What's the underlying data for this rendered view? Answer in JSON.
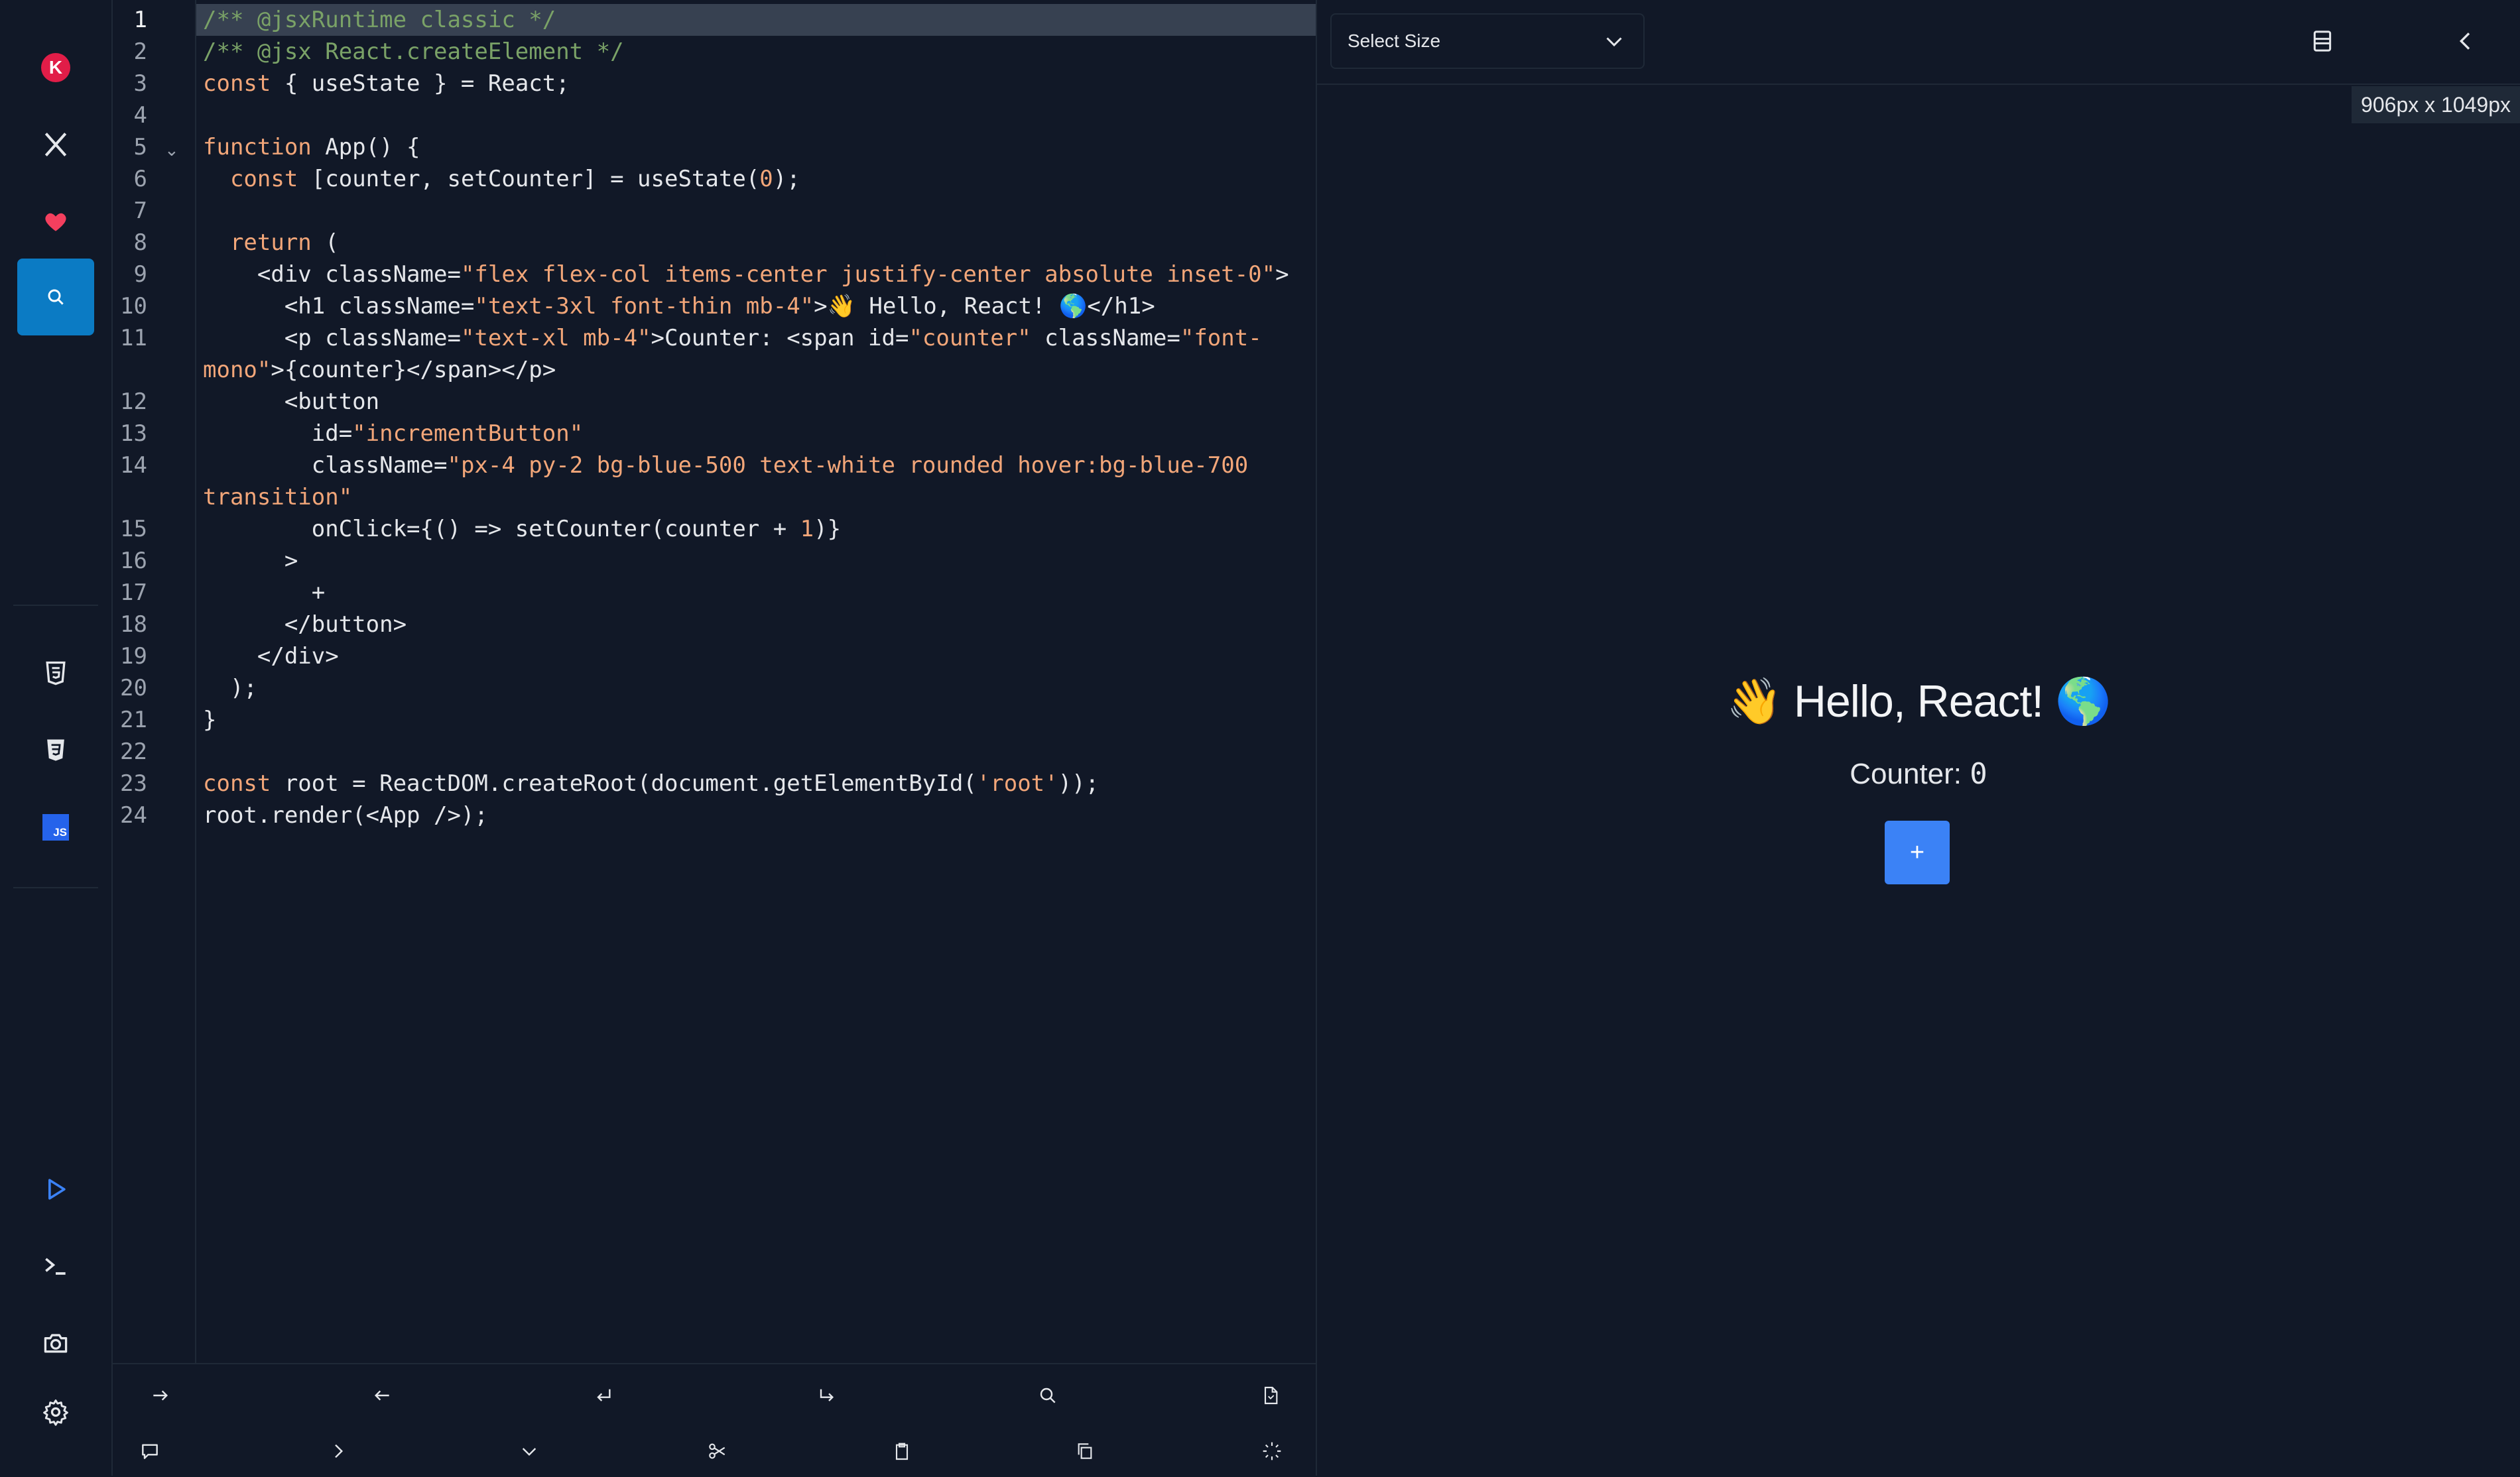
{
  "sidebar": {
    "top_icons": [
      "app-logo-icon",
      "x-twitter-icon",
      "heart-icon",
      "search-icon"
    ],
    "file_icons": [
      "html5-icon",
      "css3-icon",
      "javascript-icon"
    ],
    "bottom_icons": [
      "play-icon",
      "terminal-icon",
      "camera-icon",
      "settings-icon"
    ],
    "js_badge": "JS",
    "logo_letter": "K"
  },
  "editor": {
    "active_line": 1,
    "line_numbers": [
      "1",
      "2",
      "3",
      "4",
      "5",
      "6",
      "7",
      "8",
      "9",
      "10",
      "11",
      "",
      "12",
      "13",
      "14",
      "",
      "15",
      "16",
      "17",
      "18",
      "19",
      "20",
      "21",
      "22",
      "23",
      "24"
    ],
    "fold_marker": "⌄"
  },
  "code": [
    [
      {
        "t": "cm",
        "v": "/** @jsxRuntime classic */"
      }
    ],
    [
      {
        "t": "cm",
        "v": "/** @jsx React.createElement */"
      }
    ],
    [
      {
        "t": "kw",
        "v": "const"
      },
      {
        "t": "pl",
        "v": " { useState } = React;"
      }
    ],
    [],
    [
      {
        "t": "kw",
        "v": "function"
      },
      {
        "t": "pl",
        "v": " App() {"
      }
    ],
    [
      {
        "t": "pl",
        "v": "  "
      },
      {
        "t": "kw",
        "v": "const"
      },
      {
        "t": "pl",
        "v": " [counter, setCounter] = useState("
      },
      {
        "t": "num",
        "v": "0"
      },
      {
        "t": "pl",
        "v": ");"
      }
    ],
    [],
    [
      {
        "t": "pl",
        "v": "  "
      },
      {
        "t": "kw",
        "v": "return"
      },
      {
        "t": "pl",
        "v": " ("
      }
    ],
    [
      {
        "t": "pl",
        "v": "    <div className="
      },
      {
        "t": "str",
        "v": "\"flex flex-col items-center justify-center absolute inset-0\""
      },
      {
        "t": "pl",
        "v": ">"
      }
    ],
    [
      {
        "t": "pl",
        "v": "      <h1 className="
      },
      {
        "t": "str",
        "v": "\"text-3xl font-thin mb-4\""
      },
      {
        "t": "pl",
        "v": ">👋 Hello, React! 🌎</h1>"
      }
    ],
    [
      {
        "t": "pl",
        "v": "      <p className="
      },
      {
        "t": "str",
        "v": "\"text-xl mb-4\""
      },
      {
        "t": "pl",
        "v": ">Counter: <span id="
      },
      {
        "t": "str",
        "v": "\"counter\""
      },
      {
        "t": "pl",
        "v": " className="
      },
      {
        "t": "str",
        "v": "\"font-"
      }
    ],
    [
      {
        "t": "str",
        "v": "mono\""
      },
      {
        "t": "pl",
        "v": ">{counter}</span></p>"
      }
    ],
    [
      {
        "t": "pl",
        "v": "      <button"
      }
    ],
    [
      {
        "t": "pl",
        "v": "        id="
      },
      {
        "t": "str",
        "v": "\"incrementButton\""
      }
    ],
    [
      {
        "t": "pl",
        "v": "        className="
      },
      {
        "t": "str",
        "v": "\"px-4 py-2 bg-blue-500 text-white rounded hover:bg-blue-700"
      }
    ],
    [
      {
        "t": "str",
        "v": "transition\""
      }
    ],
    [
      {
        "t": "pl",
        "v": "        onClick={() => setCounter(counter + "
      },
      {
        "t": "num",
        "v": "1"
      },
      {
        "t": "pl",
        "v": ")}"
      }
    ],
    [
      {
        "t": "pl",
        "v": "      >"
      }
    ],
    [
      {
        "t": "pl",
        "v": "        +"
      }
    ],
    [
      {
        "t": "pl",
        "v": "      </button>"
      }
    ],
    [
      {
        "t": "pl",
        "v": "    </div>"
      }
    ],
    [
      {
        "t": "pl",
        "v": "  );"
      }
    ],
    [
      {
        "t": "pl",
        "v": "}"
      }
    ],
    [],
    [
      {
        "t": "kw",
        "v": "const"
      },
      {
        "t": "pl",
        "v": " root = ReactDOM.createRoot(document.getElementById("
      },
      {
        "t": "str",
        "v": "'root'"
      },
      {
        "t": "pl",
        "v": "));"
      }
    ],
    [
      {
        "t": "pl",
        "v": "root.render(<App />);"
      }
    ]
  ],
  "toolbar": {
    "row1": [
      "indent-icon",
      "outdent-icon",
      "newline-icon",
      "line-break-icon",
      "search-icon",
      "format-document-icon"
    ],
    "row2": [
      "comment-icon",
      "chevron-right-icon",
      "chevron-down-icon",
      "cut-icon",
      "paste-icon",
      "copy-icon",
      "magic-icon"
    ]
  },
  "preview": {
    "size_select": {
      "label": "Select Size"
    },
    "dimensions": "906px x 1049px",
    "heading": "👋 Hello, React! 🌎",
    "counter_label": "Counter: ",
    "counter_value": "0",
    "button_label": "+"
  },
  "colors": {
    "background": "#111827",
    "accent": "#0b7bc4",
    "button_blue": "#3b82f6",
    "comment": "#7aa267",
    "keyword": "#f2a679"
  }
}
